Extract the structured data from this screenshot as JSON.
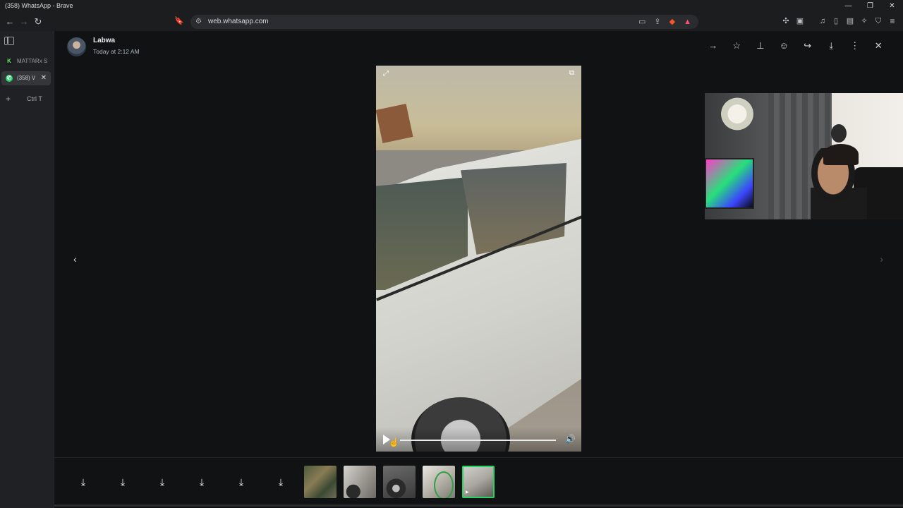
{
  "window": {
    "title": "(358) WhatsApp - Brave",
    "controls": {
      "minimize": "—",
      "restore": "❐",
      "close": "✕"
    }
  },
  "toolbar": {
    "back": "←",
    "forward": "→",
    "reload": "↻",
    "bookmark": "🔖",
    "url": "web.whatsapp.com",
    "site_info": "⚙"
  },
  "sidebar": {
    "tabs": [
      {
        "label": "MATTARx S",
        "favicon": "K"
      },
      {
        "label": "(358) V",
        "favicon": "✆",
        "close": "✕"
      }
    ],
    "new_tab": {
      "plus": "+",
      "shortcut": "Ctrl  T"
    }
  },
  "viewer": {
    "sender": "Labwa",
    "time": "Today at 2:12 AM",
    "actions": [
      "go-to-message",
      "star",
      "pin",
      "react",
      "forward",
      "download",
      "more",
      "close"
    ],
    "action_glyphs": [
      "→",
      "☆",
      "⊥",
      "☺",
      "↪",
      "⤓",
      "⋮",
      "✕"
    ],
    "prev": "‹",
    "next": "›",
    "video": {
      "expand": "⤢",
      "pip": "⧉",
      "volume": "🔊",
      "progress": 0.0,
      "playing": false
    }
  },
  "strip": {
    "downloads": [
      "⤓",
      "⤓",
      "⤓",
      "⤓",
      "⤓",
      "⤓"
    ],
    "media": [
      "photo",
      "photo",
      "photo",
      "photo",
      "video"
    ],
    "selected_index": 4,
    "accent": "#25d366"
  }
}
